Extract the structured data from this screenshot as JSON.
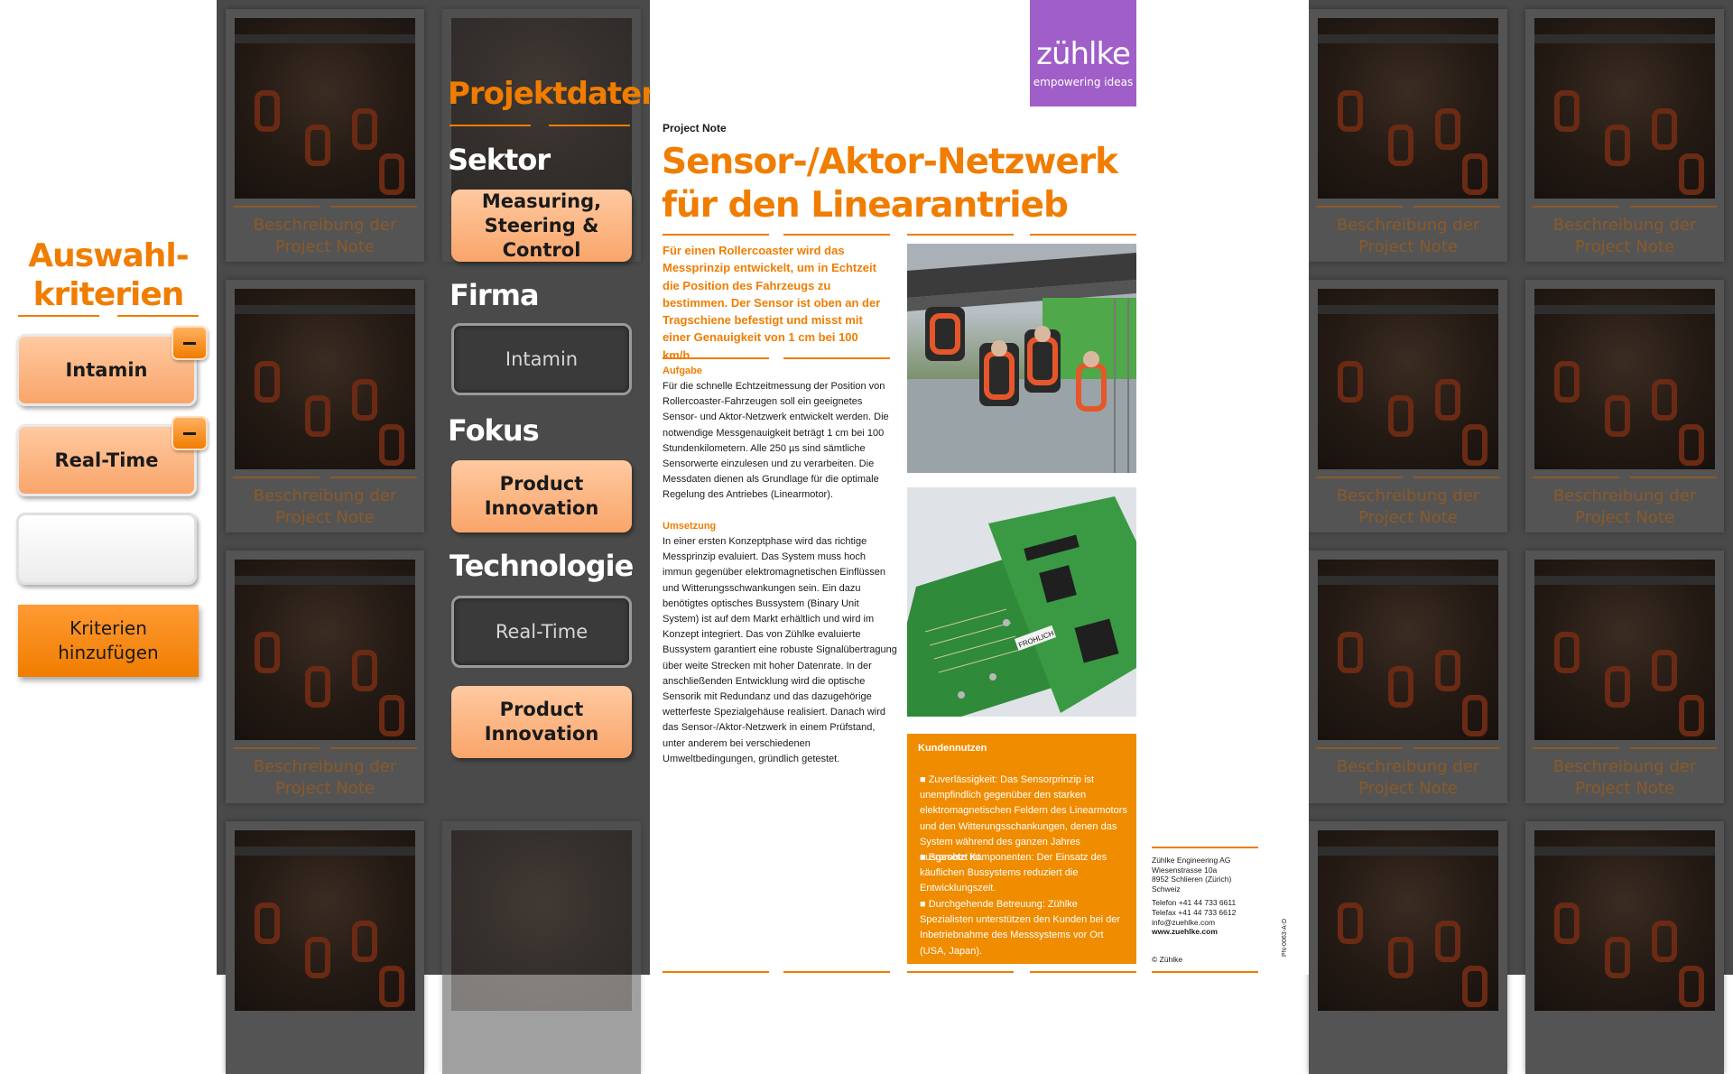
{
  "criteria_panel": {
    "heading_line1": "Auswahl-",
    "heading_line2": "kriterien",
    "selected": [
      {
        "label": "Intamin"
      },
      {
        "label": "Real-Time"
      }
    ],
    "empty_slot_label": "",
    "remove_symbol": "−",
    "add_button_line1": "Kriterien",
    "add_button_line2": "hinzufügen"
  },
  "tile_caption_line1": "Beschreibung der",
  "tile_caption_line2": "Project Note",
  "project_data": {
    "heading": "Projektdaten",
    "sector_label": "Sektor",
    "sector_value": "Measuring, Steering & Control",
    "company_label": "Firma",
    "company_value": "Intamin",
    "focus_label": "Fokus",
    "focus_value": "Product Innovation",
    "technology_label": "Technologie",
    "technology_value_1": "Real-Time",
    "technology_value_2": "Product Innovation"
  },
  "document": {
    "logo_word": "zühlke",
    "logo_tagline": "empowering ideas",
    "kicker": "Project Note",
    "title": "Sensor-/Aktor-Netzwerk für den Linearantrieb",
    "lead": "Für einen Rollercoaster wird das Messprinzip entwickelt, um in Echtzeit die Position des Fahrzeugs zu bestimmen. Der Sensor ist oben an der Tragschiene befestigt und misst mit einer Genauigkeit von 1 cm bei 100 km/h.",
    "aufgabe_heading": "Aufgabe",
    "aufgabe_text": "Für die schnelle Echtzeitmessung der Position von Rollercoaster-Fahrzeugen soll ein geeignetes Sensor- und Aktor-Netzwerk entwickelt werden. Die notwendige Messgenauigkeit beträgt 1 cm bei 100 Stundenkilometern. Alle 250 µs sind sämtliche Sensorwerte einzulesen und zu verarbeiten. Die Messdaten dienen als Grundlage für die optimale Regelung des Antriebes (Linearmotor).",
    "umsetzung_heading": "Umsetzung",
    "umsetzung_text": "In einer ersten Konzeptphase wird das richtige Messprinzip evaluiert. Das System muss hoch immun gegenüber elektromagnetischen Einflüssen und Witterungsschwankungen sein. Ein dazu benötigtes optisches Bussystem (Binary Unit System) ist auf dem Markt erhältlich und wird im Konzept integriert. Das von Zühlke evaluierte Bussystem garantiert eine robuste Signalübertragung über weite Strecken mit hoher Datenrate. In der anschließenden Entwicklung wird die optische Sensorik mit Redundanz und das dazugehörige wetterfeste Spezialgehäuse realisiert. Danach wird das Sensor-/Aktor-Netzwerk in einem Prüfstand, unter anderem bei verschiedenen Umweltbedingungen, gründlich getestet.",
    "kundennutzen_heading": "Kundennutzen",
    "kundennutzen_items": [
      "Zuverlässigkeit: Das Sensorprinzip ist unempfindlich gegenüber den starken elektromagnetischen Feldern des Linearmotors und den Witterungsschankungen, denen das System während des ganzen Jahres ausgesetzt ist.",
      "Erprobte Komponenten: Der Einsatz des käuflichen Bussystems reduziert die Entwicklungszeit.",
      "Durchgehende Betreuung: Zühlke Spezialisten unterstützen den Kunden bei der Inbetriebnahme des Messsystems vor Ort (USA, Japan)."
    ],
    "board_label": "FROHLICH",
    "address": {
      "company": "Zühlke Engineering AG",
      "street": "Wiesenstrasse 10a",
      "city": "8952 Schlieren (Zürich)",
      "country": "Schweiz",
      "phone": "Telefon +41 44 733 6611",
      "fax": "Telefax +41 44 733 6612",
      "email": "info@zuehlke.com",
      "web": "www.zuehlke.com"
    },
    "copyright": "© Zühlke",
    "doc_code": "PN-0063-A-D"
  },
  "colors": {
    "accent_orange": "#f07d00",
    "button_orange_light": "#ffc9a0",
    "dark_bg": "#4a4a4a",
    "logo_purple": "#a05ec8"
  }
}
